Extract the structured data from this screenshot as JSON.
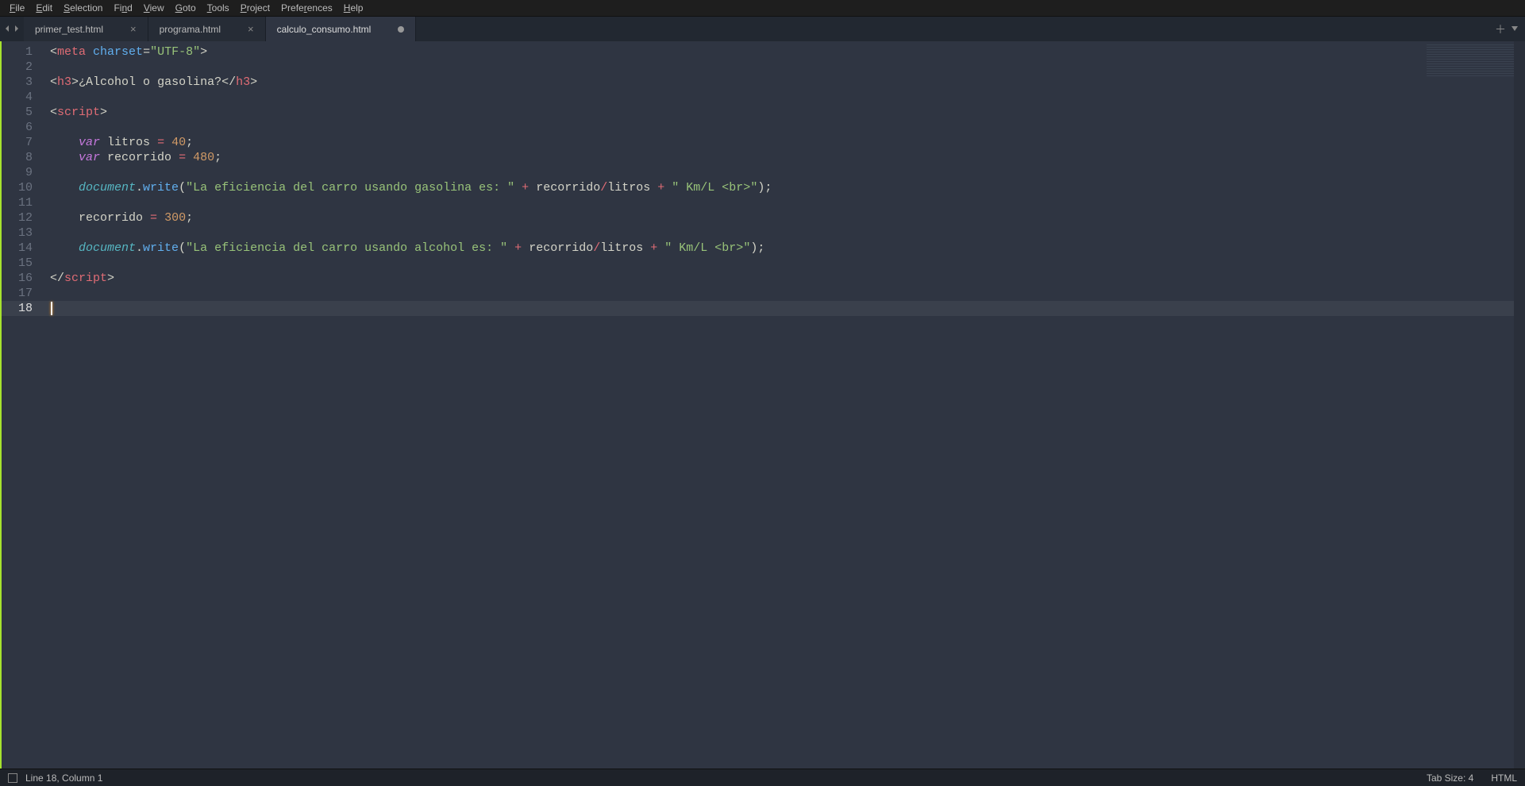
{
  "menubar": {
    "items": [
      {
        "label": "File",
        "u": 0
      },
      {
        "label": "Edit",
        "u": 0
      },
      {
        "label": "Selection",
        "u": 0
      },
      {
        "label": "Find",
        "u": 2
      },
      {
        "label": "View",
        "u": 0
      },
      {
        "label": "Goto",
        "u": 0
      },
      {
        "label": "Tools",
        "u": 0
      },
      {
        "label": "Project",
        "u": 0
      },
      {
        "label": "Preferences",
        "u": 5
      },
      {
        "label": "Help",
        "u": 0
      }
    ]
  },
  "tabs": {
    "items": [
      {
        "label": "primer_test.html",
        "dirty": false,
        "active": false
      },
      {
        "label": "programa.html",
        "dirty": false,
        "active": false
      },
      {
        "label": "calculo_consumo.html",
        "dirty": true,
        "active": true
      }
    ]
  },
  "editor": {
    "line_count": 18,
    "active_line": 18
  },
  "code": {
    "line1": {
      "tag": "meta",
      "attr": "charset",
      "val": "\"UTF-8\""
    },
    "line3": {
      "tag": "h3",
      "text": "¿Alcohol o gasolina?"
    },
    "line5": {
      "tag": "script"
    },
    "line7": {
      "kw": "var",
      "name": "litros",
      "val": "40"
    },
    "line8": {
      "kw": "var",
      "name": "recorrido",
      "val": "480"
    },
    "line10": {
      "obj": "document",
      "fn": "write",
      "str1": "\"La eficiencia del carro usando gasolina es: \"",
      "a": "recorrido",
      "b": "litros",
      "str2": "\" Km/L <br>\""
    },
    "line12": {
      "name": "recorrido",
      "val": "300"
    },
    "line14": {
      "obj": "document",
      "fn": "write",
      "str1": "\"La eficiencia del carro usando alcohol es: \"",
      "a": "recorrido",
      "b": "litros",
      "str2": "\" Km/L <br>\""
    },
    "line16": {
      "tag": "script"
    }
  },
  "statusbar": {
    "position": "Line 18, Column 1",
    "tabsize": "Tab Size: 4",
    "syntax": "HTML"
  }
}
